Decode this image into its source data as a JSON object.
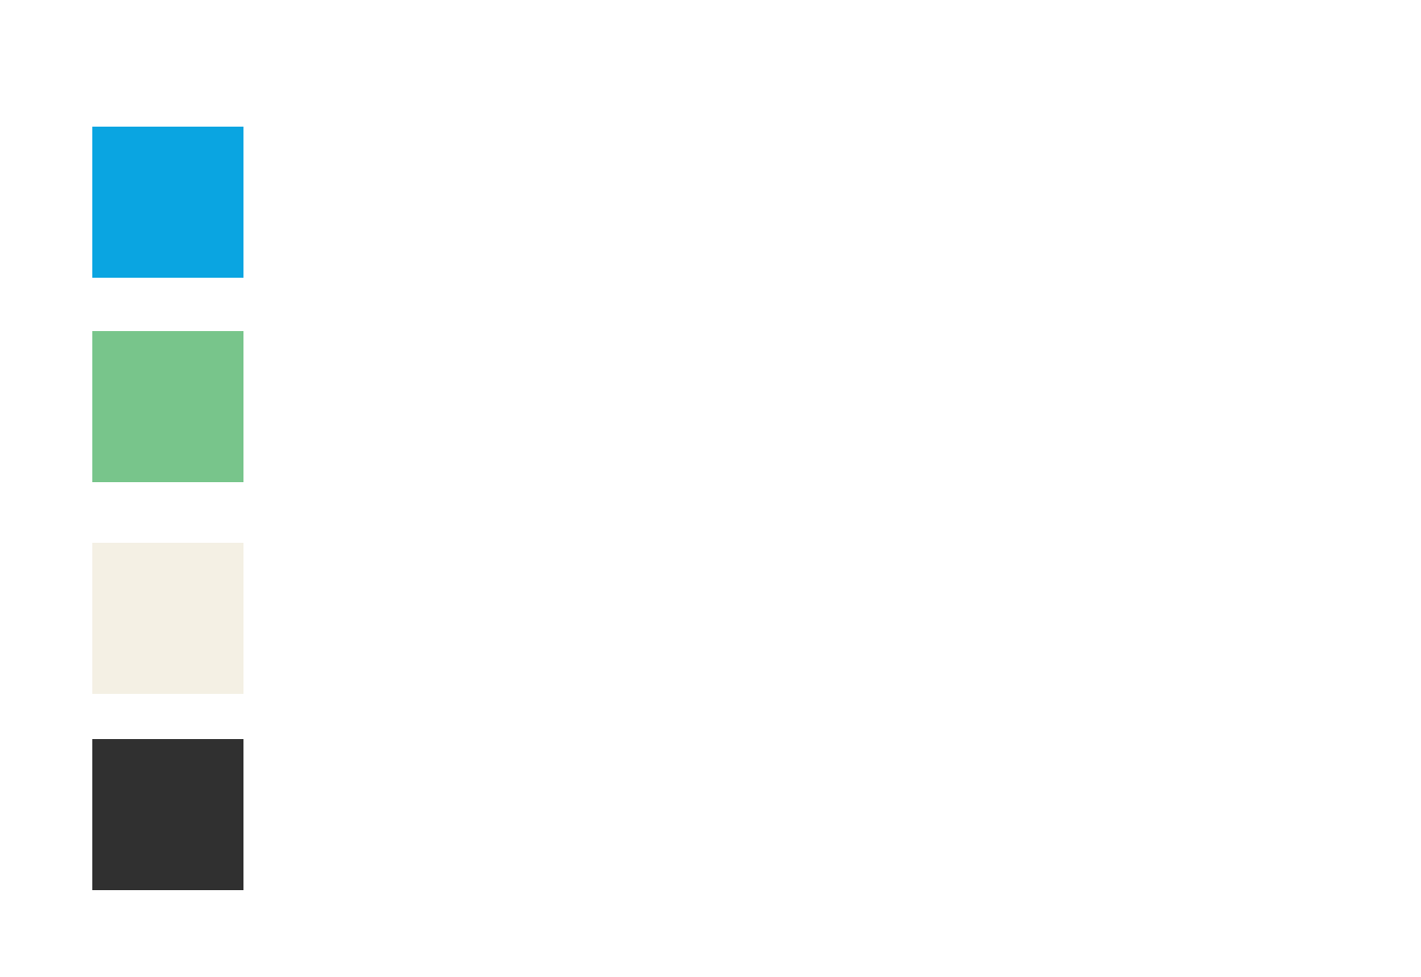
{
  "palette": {
    "swatches": [
      {
        "color": "#0aa5e1"
      },
      {
        "color": "#78c58b"
      },
      {
        "color": "#f4f0e4"
      },
      {
        "color": "#303030"
      }
    ]
  }
}
